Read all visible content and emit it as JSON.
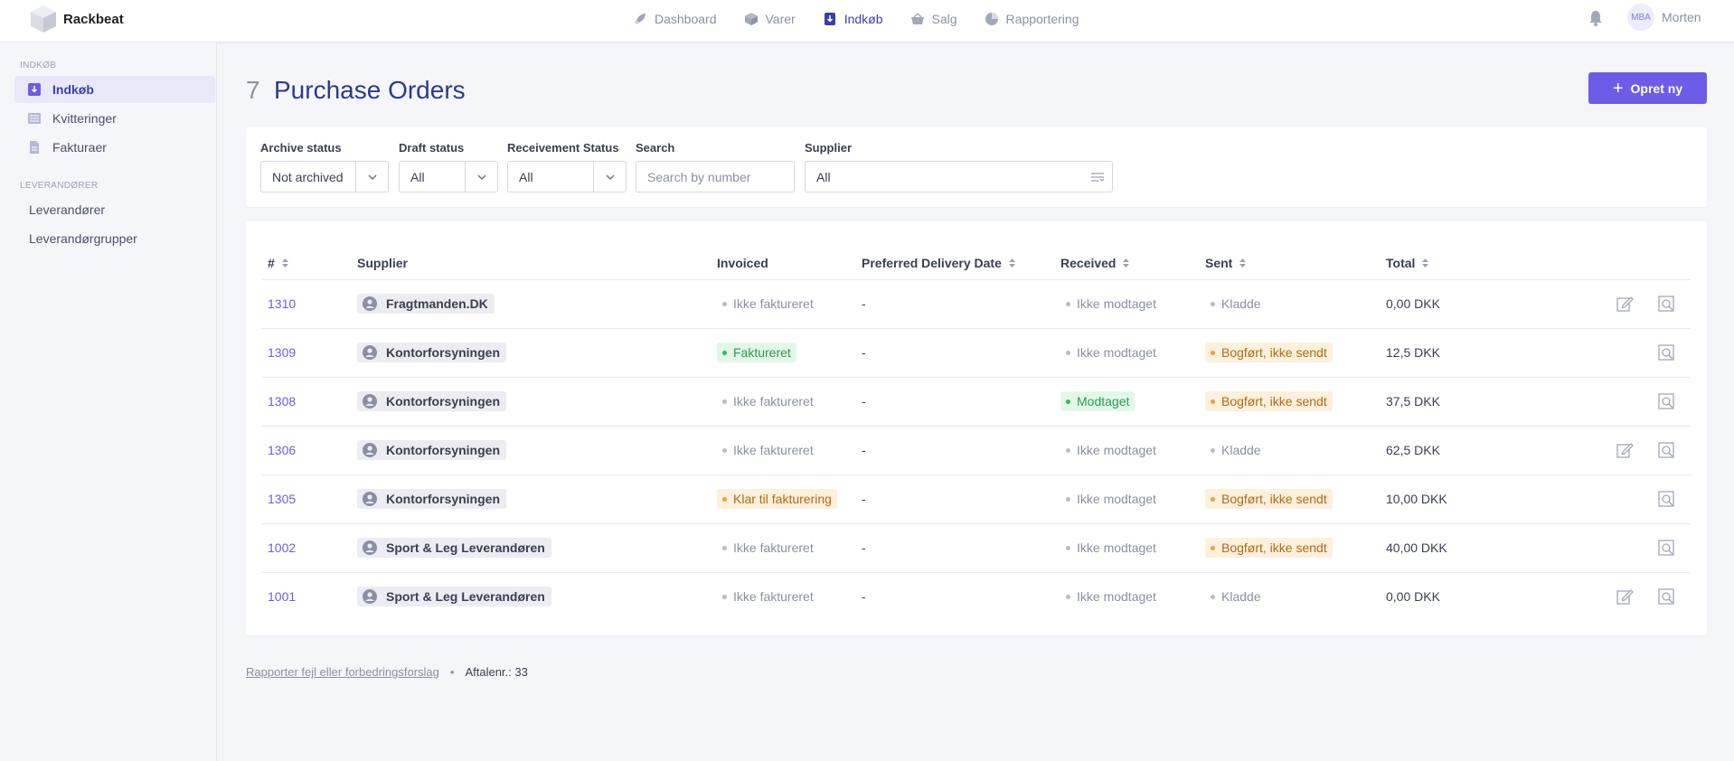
{
  "app": {
    "name": "Rackbeat"
  },
  "nav": [
    {
      "label": "Dashboard",
      "icon": "rocket-icon"
    },
    {
      "label": "Varer",
      "icon": "box-icon"
    },
    {
      "label": "Indkøb",
      "icon": "purchase-icon",
      "active": true
    },
    {
      "label": "Salg",
      "icon": "basket-icon"
    },
    {
      "label": "Rapportering",
      "icon": "pie-chart-icon"
    }
  ],
  "user": {
    "initials": "MBA",
    "name": "Morten"
  },
  "sidebar": {
    "section1": "INDKØB",
    "items1": [
      {
        "label": "Indkøb",
        "active": true
      },
      {
        "label": "Kvitteringer"
      },
      {
        "label": "Fakturaer"
      }
    ],
    "section2": "LEVERANDØRER",
    "items2": [
      {
        "label": "Leverandører"
      },
      {
        "label": "Leverandørgrupper"
      }
    ]
  },
  "page": {
    "count": "7",
    "title": "Purchase Orders",
    "create_label": "Opret ny"
  },
  "filters": {
    "archive": {
      "label": "Archive status",
      "value": "Not archived"
    },
    "draft": {
      "label": "Draft status",
      "value": "All"
    },
    "receivement": {
      "label": "Receivement Status",
      "value": "All"
    },
    "search": {
      "label": "Search",
      "placeholder": "Search by number"
    },
    "supplier": {
      "label": "Supplier",
      "value": "All"
    }
  },
  "table": {
    "headers": {
      "num": "#",
      "supplier": "Supplier",
      "invoiced": "Invoiced",
      "delivery": "Preferred Delivery Date",
      "received": "Received",
      "sent": "Sent",
      "total": "Total"
    },
    "rows": [
      {
        "num": "1310",
        "supplier": "Fragtmanden.DK",
        "invoiced": "Ikke faktureret",
        "invoiced_style": "grey",
        "delivery": "-",
        "received": "Ikke modtaget",
        "received_style": "grey",
        "sent": "Kladde",
        "sent_style": "grey",
        "total": "0,00 DKK",
        "editable": true
      },
      {
        "num": "1309",
        "supplier": "Kontorforsyningen",
        "invoiced": "Faktureret",
        "invoiced_style": "green",
        "delivery": "-",
        "received": "Ikke modtaget",
        "received_style": "grey",
        "sent": "Bogført, ikke sendt",
        "sent_style": "orange",
        "total": "12,5 DKK",
        "editable": false
      },
      {
        "num": "1308",
        "supplier": "Kontorforsyningen",
        "invoiced": "Ikke faktureret",
        "invoiced_style": "grey",
        "delivery": "-",
        "received": "Modtaget",
        "received_style": "green",
        "sent": "Bogført, ikke sendt",
        "sent_style": "orange",
        "total": "37,5 DKK",
        "editable": false
      },
      {
        "num": "1306",
        "supplier": "Kontorforsyningen",
        "invoiced": "Ikke faktureret",
        "invoiced_style": "grey",
        "delivery": "-",
        "received": "Ikke modtaget",
        "received_style": "grey",
        "sent": "Kladde",
        "sent_style": "grey",
        "total": "62,5 DKK",
        "editable": true
      },
      {
        "num": "1305",
        "supplier": "Kontorforsyningen",
        "invoiced": "Klar til fakturering",
        "invoiced_style": "orange",
        "delivery": "-",
        "received": "Ikke modtaget",
        "received_style": "grey",
        "sent": "Bogført, ikke sendt",
        "sent_style": "orange",
        "total": "10,00 DKK",
        "editable": false
      },
      {
        "num": "1002",
        "supplier": "Sport & Leg Leverandøren",
        "invoiced": "Ikke faktureret",
        "invoiced_style": "grey",
        "delivery": "-",
        "received": "Ikke modtaget",
        "received_style": "grey",
        "sent": "Bogført, ikke sendt",
        "sent_style": "orange",
        "total": "40,00 DKK",
        "editable": false
      },
      {
        "num": "1001",
        "supplier": "Sport & Leg Leverandøren",
        "invoiced": "Ikke faktureret",
        "invoiced_style": "grey",
        "delivery": "-",
        "received": "Ikke modtaget",
        "received_style": "grey",
        "sent": "Kladde",
        "sent_style": "grey",
        "total": "0,00 DKK",
        "editable": true
      }
    ]
  },
  "footer": {
    "report_link": "Rapporter fejl eller forbedringsforslag",
    "separator": "•",
    "agreement": "Aftalenr.: 33"
  },
  "colors": {
    "accent": "#6c5ce7",
    "title": "#2e3a8c",
    "green": "#2ebd59",
    "orange": "#f0a030"
  }
}
